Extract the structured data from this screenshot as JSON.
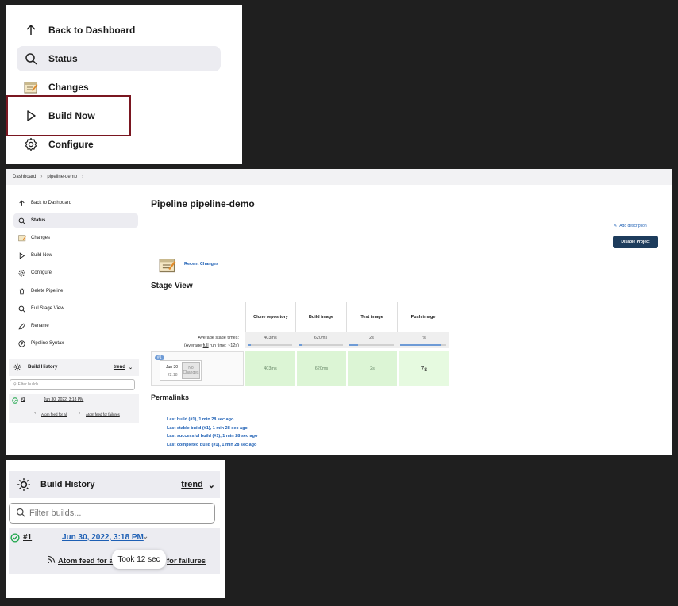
{
  "panel1": {
    "items": [
      {
        "label": "Back to Dashboard",
        "icon": "arrow-up-icon"
      },
      {
        "label": "Status",
        "icon": "search-icon"
      },
      {
        "label": "Changes",
        "icon": "notepad-icon"
      },
      {
        "label": "Build Now",
        "icon": "play-icon"
      },
      {
        "label": "Configure",
        "icon": "gear-icon"
      }
    ]
  },
  "panel2": {
    "breadcrumb": [
      "Dashboard",
      "pipeline-demo"
    ],
    "sidebar": [
      {
        "label": "Back to Dashboard",
        "icon": "arrow-up-icon"
      },
      {
        "label": "Status",
        "icon": "search-icon"
      },
      {
        "label": "Changes",
        "icon": "notepad-icon"
      },
      {
        "label": "Build Now",
        "icon": "play-icon"
      },
      {
        "label": "Configure",
        "icon": "gear-icon"
      },
      {
        "label": "Delete Pipeline",
        "icon": "trash-icon"
      },
      {
        "label": "Full Stage View",
        "icon": "search-icon"
      },
      {
        "label": "Rename",
        "icon": "pencil-icon"
      },
      {
        "label": "Pipeline Syntax",
        "icon": "help-icon"
      }
    ],
    "build_history": {
      "title": "Build History",
      "trend": "trend",
      "filter_placeholder": "Filter builds...",
      "build_number": "#1",
      "build_date": "Jun 30, 2022, 3:18 PM",
      "atom_all": "Atom feed for all",
      "atom_failures": "Atom feed for failures"
    },
    "title": "Pipeline pipeline-demo",
    "add_description": "Add description",
    "disable_project": "Disable Project",
    "recent_changes": "Recent Changes",
    "stage_view": {
      "title": "Stage View",
      "stages": [
        "Clone repository",
        "Build image",
        "Test image",
        "Push image"
      ],
      "avg_label": "Average stage times:",
      "avg_full_prefix": "(Average ",
      "avg_full_word": "full",
      "avg_full_suffix": " run time: ~12s)",
      "avg_times": [
        "403ms",
        "620ms",
        "2s",
        "7s"
      ],
      "avg_fill": [
        0.05,
        0.08,
        0.2,
        0.9
      ],
      "run_badge": "#1",
      "run_date": "Jun 30",
      "run_time": "22:18",
      "no_changes": "No Changes",
      "run_times": [
        "403ms",
        "620ms",
        "2s",
        "7s"
      ]
    },
    "permalinks_title": "Permalinks",
    "permalinks": [
      "Last build (#1), 1 min 28 sec ago",
      "Last stable build (#1), 1 min 28 sec ago",
      "Last successful build (#1), 1 min 28 sec ago",
      "Last completed build (#1), 1 min 28 sec ago"
    ]
  },
  "panel3": {
    "title": "Build History",
    "trend": "trend",
    "filter_placeholder": "Filter builds...",
    "build_number": "#1",
    "build_date": "Jun 30, 2022, 3:18 PM",
    "atom_all": "Atom feed for all",
    "atom_failures": "for failures",
    "tooltip": "Took 12 sec"
  }
}
